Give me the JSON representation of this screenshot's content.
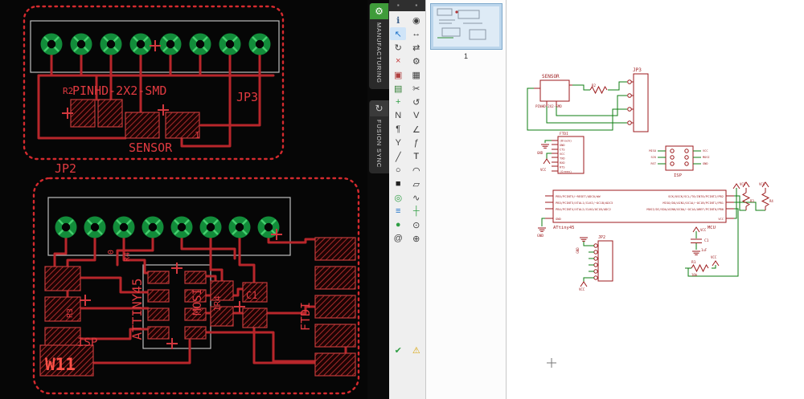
{
  "board": {
    "labels": {
      "r2": "R2",
      "pinhd": "PINHD-2X2-SMD",
      "jp3": "JP3",
      "sensor": "SENSOR",
      "pin1": "1",
      "jp2": "JP2",
      "r3": "R3",
      "zero": "0",
      "r4": "R4",
      "attiny": "ATTINY45",
      "mosi": "MOSI",
      "r4_value": "1R4",
      "c1": "C1",
      "ftdi": "FTDI",
      "isp": "ISP",
      "w11": "W11"
    }
  },
  "side_tabs": [
    {
      "label": "MANUFACTURING"
    },
    {
      "label": "FUSION SYNC"
    }
  ],
  "toolbar": {
    "icons": [
      {
        "name": "info-tool",
        "glyph": "ℹ",
        "color": "#3b5f8a"
      },
      {
        "name": "show-tool",
        "glyph": "◉",
        "color": "#3f3f3f"
      },
      {
        "name": "select-tool",
        "glyph": "↖",
        "color": "#1d71c9",
        "bg": "#cfe4f8"
      },
      {
        "name": "move-tool",
        "glyph": "↔",
        "color": "#3f3f3f"
      },
      {
        "name": "rotate-tool",
        "glyph": "↻",
        "color": "#3f3f3f"
      },
      {
        "name": "mirror-tool",
        "glyph": "⇄",
        "color": "#3f3f3f"
      },
      {
        "name": "delete-tool",
        "glyph": "×",
        "color": "#c43c3c"
      },
      {
        "name": "change-tool",
        "glyph": "⚙",
        "color": "#3f3f3f"
      },
      {
        "name": "copy-tool",
        "glyph": "▣",
        "color": "#b04040"
      },
      {
        "name": "group-tool",
        "glyph": "▦",
        "color": "#3f3f3f"
      },
      {
        "name": "paste-tool",
        "glyph": "▤",
        "color": "#2f7d32"
      },
      {
        "name": "cut-tool",
        "glyph": "✂",
        "color": "#3f3f3f"
      },
      {
        "name": "add-part-tool",
        "glyph": "+",
        "color": "#2f9e44"
      },
      {
        "name": "replace-tool",
        "glyph": "↺",
        "color": "#3f3f3f"
      },
      {
        "name": "name-tool",
        "glyph": "N",
        "color": "#3f3f3f"
      },
      {
        "name": "value-tool",
        "glyph": "V",
        "color": "#3f3f3f"
      },
      {
        "name": "smash-tool",
        "glyph": "¶",
        "color": "#3f3f3f"
      },
      {
        "name": "miter-tool",
        "glyph": "∠",
        "color": "#3f3f3f"
      },
      {
        "name": "split-tool",
        "glyph": "Y",
        "color": "#3f3f3f"
      },
      {
        "name": "invoke-tool",
        "glyph": "ƒ",
        "color": "#3f3f3f"
      },
      {
        "name": "wire-tool",
        "glyph": "╱",
        "color": "#3f3f3f"
      },
      {
        "name": "text-tool",
        "glyph": "T",
        "color": "#222222"
      },
      {
        "name": "circle-tool",
        "glyph": "○",
        "color": "#222222"
      },
      {
        "name": "arc-tool",
        "glyph": "◠",
        "color": "#222222"
      },
      {
        "name": "rect-tool",
        "glyph": "■",
        "color": "#222222"
      },
      {
        "name": "polygon-tool",
        "glyph": "▱",
        "color": "#222222"
      },
      {
        "name": "via-tool",
        "glyph": "◎",
        "color": "#2f9e44"
      },
      {
        "name": "signal-tool",
        "glyph": "∿",
        "color": "#3f3f3f"
      },
      {
        "name": "bus-tool",
        "glyph": "≡",
        "color": "#1d71c9"
      },
      {
        "name": "net-tool",
        "glyph": "┼",
        "color": "#2f9e44"
      },
      {
        "name": "junction-tool",
        "glyph": "●",
        "color": "#2f9e44"
      },
      {
        "name": "label-tool",
        "glyph": "⊙",
        "color": "#3f3f3f"
      },
      {
        "name": "attribute-tool",
        "glyph": "@",
        "color": "#3f3f3f"
      },
      {
        "name": "mark-tool",
        "glyph": "⊕",
        "color": "#3f3f3f"
      }
    ],
    "bottom_icons": [
      {
        "name": "erc-tool",
        "glyph": "✔",
        "color": "#2f9e44"
      },
      {
        "name": "errors-tool",
        "glyph": "⚠",
        "color": "#d9a40a"
      }
    ]
  },
  "sheets": {
    "page_label": "1"
  },
  "schematic": {
    "power": {
      "vcc": "VCC",
      "gnd": "GND"
    },
    "sensor": {
      "name": "SENSOR",
      "value": "PINHD-2X2-SMD"
    },
    "r2": {
      "name": "R2"
    },
    "jp3": {
      "name": "JP3"
    },
    "ftdi": {
      "name": "FTDI",
      "pins": [
        "(Black)",
        "GND",
        "CTS",
        "VCC",
        "TXD",
        "RXD",
        "RTS",
        "(Green)"
      ]
    },
    "isp": {
      "name": "ISP",
      "left_pins": [
        "MISO",
        "SCK",
        "RST"
      ],
      "right_pins": [
        "VCC",
        "MOSI",
        "GND"
      ]
    },
    "mcu": {
      "name": "ATtiny45",
      "part": "MCU",
      "left_pins": [
        "PB5/PCINT5/~RESET/ADC0/dW",
        "PB3/PCINT3/XTAL1/CLKI/~OC1B/ADC3",
        "PB4/PCINT4/XTAL2/CLKO/OC1B/ADC2",
        "GND"
      ],
      "right_pins": [
        "SCK/USCK/SCL/T0/INT0/PCINT2/PB2",
        "MISO/DO/AIN1/OC1A/~OC1B/PCINT1/PB1",
        "MOSI/DI/SDA/AIN0/OC0A/~OC1A/AREF/PCINT0/PB0",
        "VCC"
      ]
    },
    "jp2": {
      "name": "JP2"
    },
    "c1": {
      "name": "C1",
      "value": "1uF"
    },
    "r1": {
      "name": "R1",
      "value": "10k"
    },
    "r3": {
      "name": "R3"
    },
    "r4": {
      "name": "R4"
    }
  },
  "colors": {
    "trace_red": "#b8262b",
    "pad_green": "#128c3a",
    "net_green": "#0e7d12",
    "symbol_red": "#9c1a1c",
    "selection_blue": "#cfe4f8",
    "manufacturing_green": "#3f9c3a",
    "warning_yellow": "#d9a40a"
  }
}
